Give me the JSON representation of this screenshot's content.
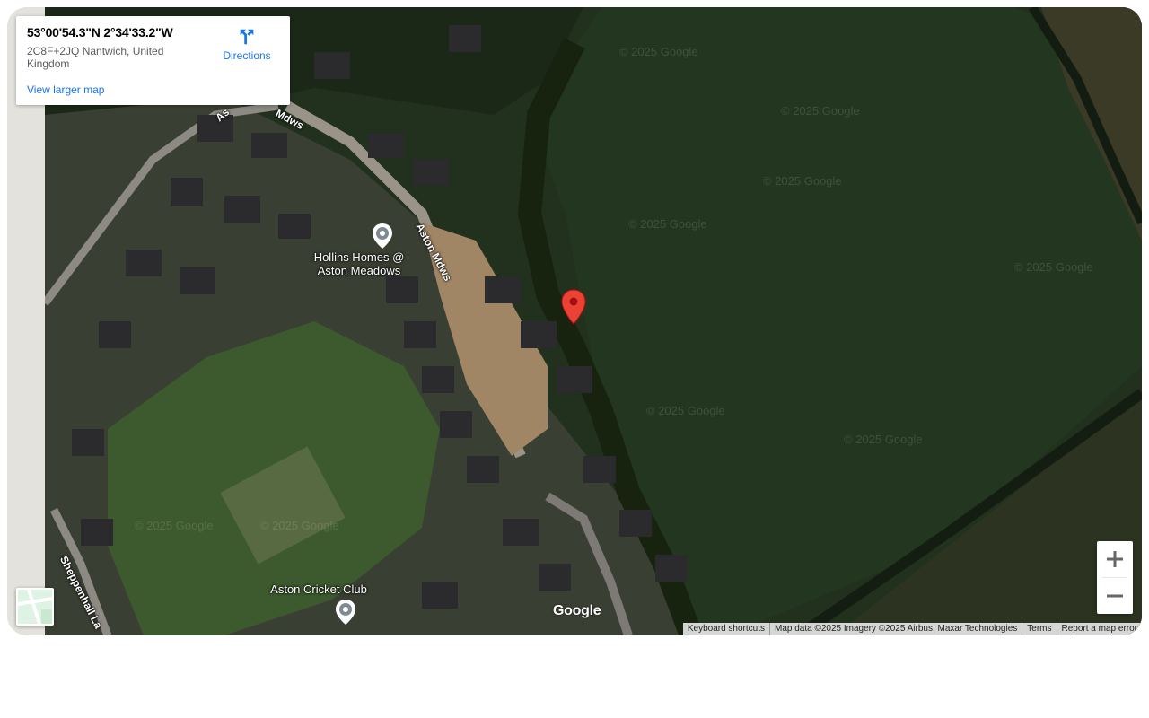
{
  "info_card": {
    "coordinates": "53°00'54.3\"N 2°34'33.2\"W",
    "address": "2C8F+2JQ Nantwich, United Kingdom",
    "view_larger_map": "View larger map",
    "directions_label": "Directions"
  },
  "places": {
    "hollins_homes": "Hollins Homes @\nAston Meadows",
    "cricket_club": "Aston Cricket Club"
  },
  "roads": {
    "aston_mdws_1": "Aston Mdws",
    "aston_mdws_2": "Mdws",
    "aston_partial": "As",
    "sheppenhall": "Sheppenhall La"
  },
  "watermark": "© 2025 Google",
  "google_logo": "Google",
  "zoom": {
    "in_symbol": "+",
    "out_symbol": "−"
  },
  "attribution": {
    "keyboard": "Keyboard shortcuts",
    "map_data": "Map data ©2025 Imagery ©2025 Airbus, Maxar Technologies",
    "terms": "Terms",
    "report": "Report a map error"
  },
  "colors": {
    "link_blue": "#1a73e8",
    "pin_red": "#ea4335",
    "field_green": "#24321f"
  },
  "icons": {
    "directions": "directions-icon",
    "pin": "location-pin-icon",
    "poi": "poi-marker-icon",
    "zoom_in": "plus-icon",
    "zoom_out": "minus-icon"
  }
}
